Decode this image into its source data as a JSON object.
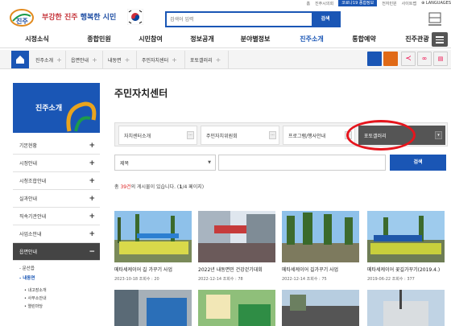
{
  "top_links": [
    "홈",
    "진주시의회",
    "코로나19 종합정보",
    "전자민원",
    "사이트맵"
  ],
  "top_corona": "코로나19 종합정보",
  "top_language": "LANGUAGES",
  "brand": {
    "city": "진주",
    "slogan_prefix": "부강한 진주",
    "slogan_suffix": "행복한 시민"
  },
  "search": {
    "placeholder": "검색어 입력",
    "button": "검색"
  },
  "nav": [
    "시정소식",
    "종합민원",
    "시민참여",
    "정보공개",
    "분야별정보",
    "진주소개",
    "통합예약",
    "진주관광"
  ],
  "breadcrumb": [
    "진주소개",
    "읍면안내",
    "내동면",
    "주민자치센터",
    "포토갤러리"
  ],
  "sidebar": {
    "title": "진주소개",
    "items": [
      "기본현황",
      "시정안내",
      "시청조합안내",
      "실과안내",
      "직속기관안내",
      "사업소안내",
      "읍면안내"
    ],
    "sub": [
      "문산읍",
      "내동면"
    ],
    "sub3": [
      "내고장소개",
      "사무소안내",
      "열린마당"
    ]
  },
  "page_title": "주민자치센터",
  "tabs": [
    "자치센터소개",
    "주민자치위원회",
    "프로그램/행사안내",
    "포토갤러리"
  ],
  "dd_glyph": "···",
  "active_tab": "포토갤러리",
  "filter": {
    "select": "제목",
    "button": "검색"
  },
  "count": {
    "prefix": "총 ",
    "total": "39건",
    "mid": "의 게시물이 있습니다. (",
    "page": "1",
    "suffix": "/4 페이지)"
  },
  "gallery": [
    {
      "title": "메타세케이어 길 가꾸기 사업",
      "date": "2023-10-18",
      "views": "조회수 : 20"
    },
    {
      "title": "2022년 내동면민 건강걷기대회",
      "date": "2022-12-14",
      "views": "조회수 : 78"
    },
    {
      "title": "메타세케이어 길가꾸기 사업",
      "date": "2022-12-14",
      "views": "조회수 : 75"
    },
    {
      "title": "메타세케이어 꽃길가꾸기(2019.4.)",
      "date": "2019-06-22",
      "views": "조회수 : 377"
    }
  ],
  "colors": {
    "brand_blue": "#1a56b5",
    "highlight_red": "#e6151d",
    "slogan_red": "#c6373d"
  }
}
